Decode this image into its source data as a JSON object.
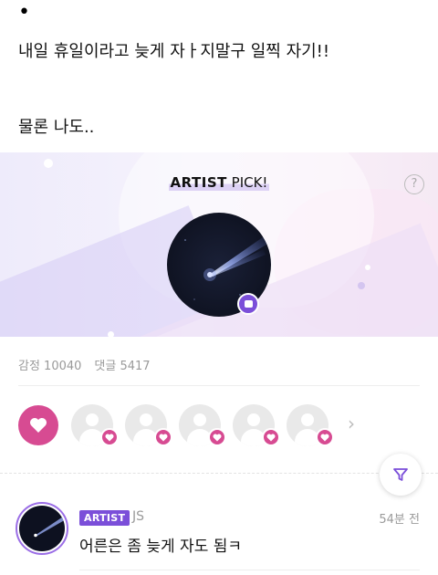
{
  "post": {
    "bullet": "•",
    "line1": "내일 휴일이라고 늦게 자ㅏ지말구 일찍 자기!!",
    "line2": "물론 나도.."
  },
  "pick": {
    "title_bold": "ARTIST",
    "title_regular": "PICK!",
    "help_symbol": "?"
  },
  "stats": {
    "emotions": "감정 10040",
    "comments": "댓글 5417"
  },
  "reactions": {
    "main_icon": "heart-icon",
    "more_icon": "chevron-right-icon",
    "chevron": "›",
    "accent": "#d74b92"
  },
  "comment": {
    "tag": "ARTIST",
    "author": "JS",
    "time": "54분 전",
    "body": "어른은 좀 늦게 자도 됨ㅋ",
    "accent": "#7b4fd9"
  }
}
